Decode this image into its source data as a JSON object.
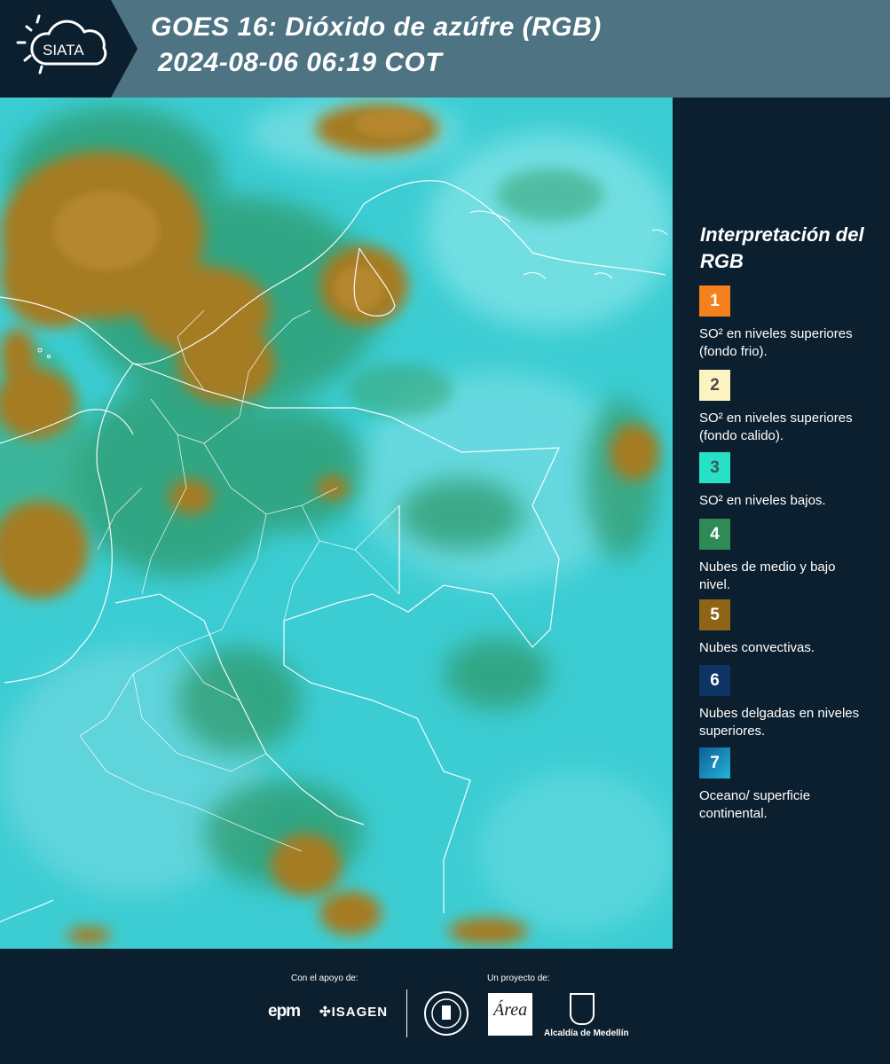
{
  "header": {
    "logo_text": "SIATA",
    "title_line1": "GOES 16: Dióxido de azúfre (RGB)",
    "title_line2": "2024-08-06 06:19 COT"
  },
  "legend": {
    "title": "Interpretación del RGB",
    "items": [
      {
        "number": "1",
        "text": "SO² en niveles superiores (fondo frio).",
        "color": "#f5801e",
        "number_color": "#ffffff"
      },
      {
        "number": "2",
        "text": "SO² en niveles superiores (fondo calido).",
        "color": "#fbf3c0",
        "number_color": "#4a4a4a"
      },
      {
        "number": "3",
        "text": "SO² en niveles bajos.",
        "color": "#27e1c7",
        "number_color": "#3a5a5a"
      },
      {
        "number": "4",
        "text": "Nubes de medio y bajo nivel.",
        "color": "#2f8a55",
        "number_color": "#ffffff"
      },
      {
        "number": "5",
        "text": "Nubes convectivas.",
        "color": "#8e6417",
        "number_color": "#ffffff"
      },
      {
        "number": "6",
        "text": "Nubes delgadas en niveles superiores.",
        "color": "#0d3463",
        "number_color": "#ffffff"
      },
      {
        "number": "7",
        "text": "Oceano/ superficie continental.",
        "color": "#1a8fb8",
        "number_color": "#ffffff"
      }
    ]
  },
  "footer": {
    "support_label": "Con el apoyo de:",
    "project_label": "Un proyecto de:",
    "epm": "epm",
    "isagen": "ISAGEN",
    "area_logo": "Área",
    "alcaldia": "Alcaldía de Medellín"
  }
}
